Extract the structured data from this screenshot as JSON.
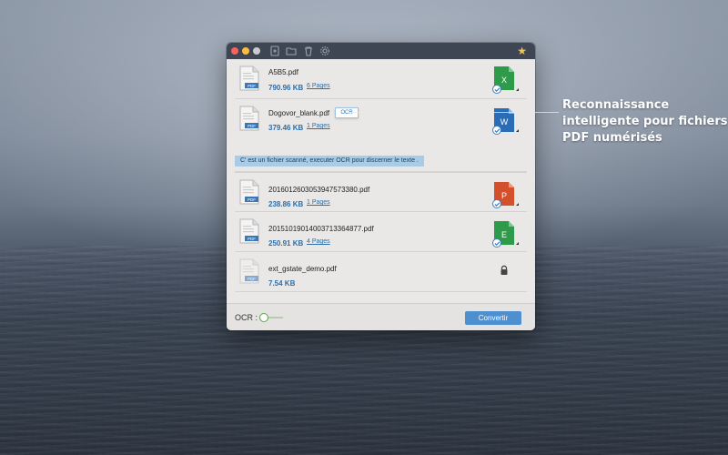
{
  "window": {
    "toolbar_icons": [
      "add-file-icon",
      "folder-icon",
      "trash-icon",
      "gear-icon"
    ],
    "star_icon": "star-icon"
  },
  "files": [
    {
      "name": "A5B5.pdf",
      "size": "790.96 KB",
      "pages": "6 Pages",
      "target": "X",
      "target_color": "#2e9b4b",
      "icon": "excel-icon",
      "checked": true
    },
    {
      "name": "Dogovor_blank.pdf",
      "size": "379.46 KB",
      "pages": "1 Pages",
      "target": "W",
      "target_color": "#2b6cb6",
      "icon": "word-icon",
      "checked": true,
      "ocr_badge": "OCR",
      "hint": "C' est un fichier scanné, executer OCR pour discerner le texte ."
    },
    {
      "name": "20160126030539475733 80.pdf",
      "size": "238.86 KB",
      "pages": "1 Pages",
      "target": "P",
      "target_color": "#d2502c",
      "icon": "powerpoint-icon",
      "checked": true
    },
    {
      "name": "20151019014003713364877.pdf",
      "size": "250.91 KB",
      "pages": "4 Pages",
      "target": "E",
      "target_color": "#2e9b4b",
      "icon": "epub-icon",
      "checked": true
    },
    {
      "name": "ext_gstate_demo.pdf",
      "size": "7.54 KB",
      "pages": "",
      "icon": "lock-icon",
      "locked": true
    }
  ],
  "footer": {
    "ocr_label": "OCR :",
    "ocr_enabled": false,
    "convert_label": "Convertir"
  },
  "callout": {
    "line1": "Reconnaissance",
    "line2": "intelligente pour fichiers",
    "line3": "PDF numérisés"
  },
  "colors": {
    "accent": "#4d8fcf",
    "link": "#2f6ea8",
    "titlebar": "#3f4653",
    "hint_bg": "#a8cbe6"
  }
}
